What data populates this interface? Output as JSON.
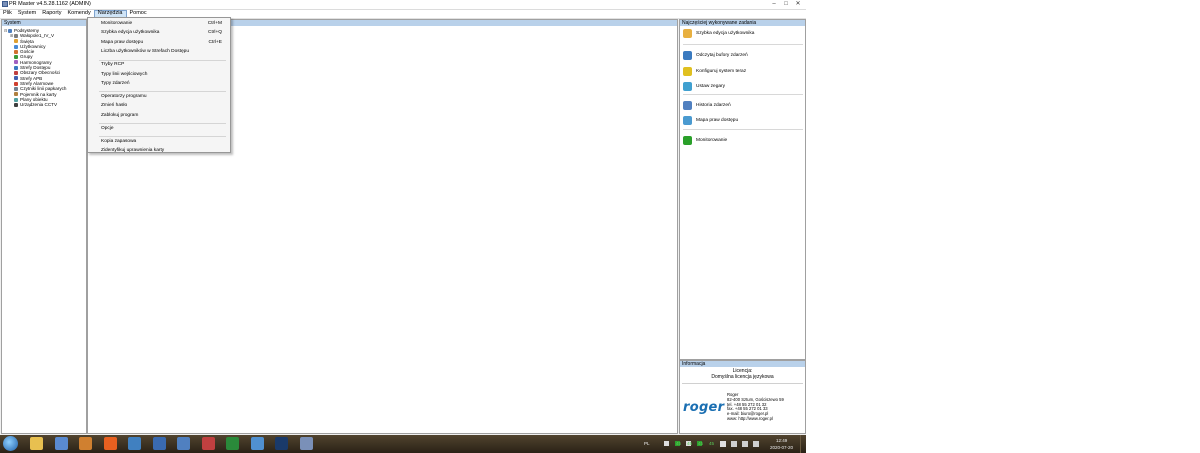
{
  "window": {
    "title": "PR Master v4.5.28.1162 (ADMIN)",
    "min_glyph": "–",
    "max_glyph": "□",
    "close_glyph": "✕"
  },
  "menubar": {
    "items": [
      "Plik",
      "System",
      "Raporty",
      "Komendy",
      "Narzędzia",
      "Pomoc"
    ],
    "active": "Narzędzia"
  },
  "tree_panel": {
    "header": "System",
    "items": [
      {
        "label": "Podsystemy",
        "expander": "⊟",
        "icon": "network-icon",
        "color": "#4d7fbf"
      },
      {
        "label": "Wałopole1_IV_V",
        "expander": "⊞",
        "icon": "controller-icon",
        "color": "#7c7c7c"
      },
      {
        "label": "Święta",
        "expander": "",
        "icon": "calendar-icon",
        "color": "#e0a030"
      },
      {
        "label": "Użytkownicy",
        "expander": "",
        "icon": "users-icon",
        "color": "#4a8ad4"
      },
      {
        "label": "Goście",
        "expander": "",
        "icon": "guest-icon",
        "color": "#d07030"
      },
      {
        "label": "Grupy",
        "expander": "",
        "icon": "groups-icon",
        "color": "#3a9a3a"
      },
      {
        "label": "Harmonogramy",
        "expander": "",
        "icon": "schedule-icon",
        "color": "#a060c0"
      },
      {
        "label": "Strefy Dostępu",
        "expander": "",
        "icon": "zone-icon",
        "color": "#3a7ac0"
      },
      {
        "label": "Obszary Obecności",
        "expander": "",
        "icon": "area-icon",
        "color": "#c04040"
      },
      {
        "label": "Strefy APB",
        "expander": "",
        "icon": "apb-icon",
        "color": "#4060b0"
      },
      {
        "label": "Strefy Alarmowe",
        "expander": "",
        "icon": "alarm-icon",
        "color": "#d04030"
      },
      {
        "label": "Czytniki linii papkarych",
        "expander": "",
        "icon": "reader-icon",
        "color": "#708090"
      },
      {
        "label": "Pojemnik na karty",
        "expander": "",
        "icon": "card-box-icon",
        "color": "#b08040"
      },
      {
        "label": "Plany obiektu",
        "expander": "",
        "icon": "floorplan-icon",
        "color": "#50a0a0"
      },
      {
        "label": "Urządzenia CCTV",
        "expander": "",
        "icon": "cctv-icon",
        "color": "#404040"
      }
    ]
  },
  "dropdown": {
    "groups": [
      [
        {
          "label": "Monitorowanie",
          "shortcut": "Ctrl+M"
        },
        {
          "label": "Szybka edycja użytkownika",
          "shortcut": "Ctrl+Q"
        },
        {
          "label": "Mapa praw dostępu",
          "shortcut": "Ctrl+E"
        },
        {
          "label": "Liczba użytkowników w Strefach Dostępu",
          "shortcut": ""
        }
      ],
      [
        {
          "label": "Tryby RCP",
          "shortcut": ""
        },
        {
          "label": "Typy linii wejściowych",
          "shortcut": ""
        },
        {
          "label": "Typy zdarzeń",
          "shortcut": ""
        }
      ],
      [
        {
          "label": "Operatorzy programu",
          "shortcut": ""
        },
        {
          "label": "Zmień hasło",
          "shortcut": ""
        },
        {
          "label": "Zablokuj program",
          "shortcut": ""
        }
      ],
      [
        {
          "label": "Opcje",
          "shortcut": ""
        }
      ],
      [
        {
          "label": "Kopia zapasowa",
          "shortcut": ""
        },
        {
          "label": "Zidentyfikuj uprawnienia karty",
          "shortcut": ""
        }
      ]
    ]
  },
  "right_panel": {
    "header": "Najczęściej wykonywane zadania",
    "groups": [
      [
        {
          "label": "Szybka edycja użytkownika",
          "icon": "user-edit-icon",
          "color": "#e8b040"
        }
      ],
      [
        {
          "label": "Odczytaj bufory zdarzeń",
          "icon": "buffer-read-icon",
          "color": "#3a7ac0"
        },
        {
          "label": "Konfiguruj system teraz",
          "icon": "pencil-icon",
          "color": "#e0c020"
        },
        {
          "label": "Ustaw zegary",
          "icon": "clock-icon",
          "color": "#40a0d0"
        }
      ],
      [
        {
          "label": "Historia zdarzeń",
          "icon": "history-icon",
          "color": "#5080c0"
        },
        {
          "label": "Mapa praw dostępu",
          "icon": "map-icon",
          "color": "#4a9ad0"
        }
      ],
      [
        {
          "label": "Monitorowanie",
          "icon": "monitoring-icon",
          "color": "#2aa02a"
        }
      ]
    ]
  },
  "info_panel": {
    "header": "Informacja",
    "license_title": "Licencja:",
    "license_value": "Domyślna licencja językowa",
    "logo": "roger",
    "contact": [
      "Roger",
      "82-400 Sztum, Gościszewo 59",
      "tel. +48 55 272 01 32",
      "fax. +48 55 272 01 33",
      "e-mail: biuro@roger.pl",
      "www: http://www.roger.pl"
    ]
  },
  "taskbar": {
    "apps": [
      {
        "name": "explorer-icon",
        "color": "#e8c050"
      },
      {
        "name": "network-app-icon",
        "color": "#5a8ad0"
      },
      {
        "name": "media-player-icon",
        "color": "#d08030"
      },
      {
        "name": "firefox-icon",
        "color": "#e86020"
      },
      {
        "name": "window-icon",
        "color": "#4080c0"
      },
      {
        "name": "save-icon",
        "color": "#3a6ab0"
      },
      {
        "name": "remote-desktop-icon",
        "color": "#5080c0"
      },
      {
        "name": "paint-icon",
        "color": "#c04040"
      },
      {
        "name": "excel-icon",
        "color": "#2a8a3a"
      },
      {
        "name": "image-viewer-icon",
        "color": "#5090d0"
      },
      {
        "name": "steam-icon",
        "color": "#1a3a6a"
      },
      {
        "name": "prmaster-icon",
        "color": "#7a90b8"
      }
    ],
    "language": "PL",
    "tray_nums": [
      "45",
      "45",
      "45",
      "45"
    ],
    "time": "12:49",
    "date": "2020-07-20"
  }
}
